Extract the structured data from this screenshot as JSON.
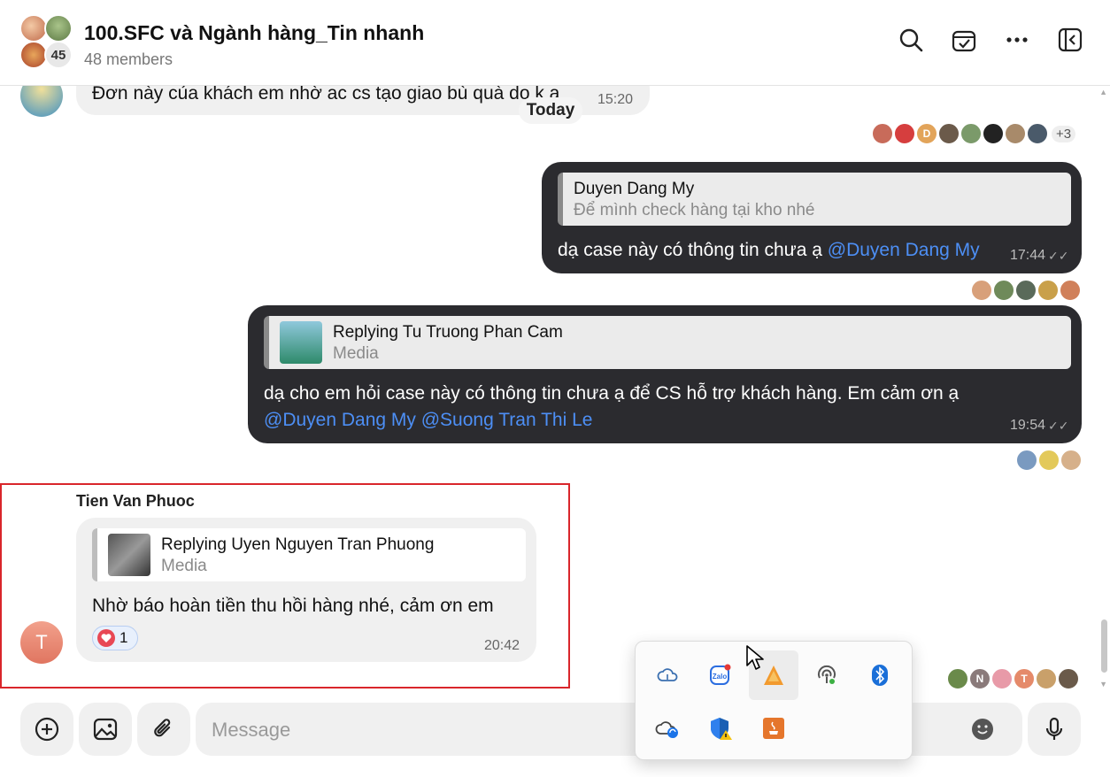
{
  "header": {
    "title": "100.SFC và Ngành hàng_Tin nhanh",
    "members": "48 members",
    "avatar_count": "45"
  },
  "date_divider": "Today",
  "messages": [
    {
      "text": "Đơn này của khách em nhờ ac cs tạo giao bù quà do k a",
      "time": "15:20",
      "seen_more": "+3"
    },
    {
      "quote_name": "Duyen Dang My",
      "quote_text": "Để mình check hàng tại kho nhé",
      "text": "dạ case này có thông tin chưa ạ ",
      "mention": "@Duyen Dang My",
      "time": "17:44"
    },
    {
      "quote_name": "Replying Tu Truong Phan Cam",
      "quote_text": "Media",
      "text": "dạ cho em hỏi case này có thông tin chưa ạ để CS hỗ trợ khách hàng. Em cảm ơn ạ",
      "mention1": "@Duyen Dang My",
      "mention2": "@Suong Tran Thi Le",
      "time": "19:54"
    },
    {
      "sender": "Tien Van Phuoc",
      "avatar_letter": "T",
      "quote_name": "Replying Uyen Nguyen Tran Phuong",
      "quote_text": "Media",
      "text": "Nhờ báo hoàn tiền thu hồi hàng nhé, cảm ơn em",
      "reaction_count": "1",
      "time": "20:42"
    }
  ],
  "seen_avatars_last": [
    "",
    "N",
    "",
    "T",
    "",
    ""
  ],
  "composer": {
    "placeholder": "Message"
  },
  "tray": {
    "icons": [
      "onedrive-icon",
      "zalo-icon",
      "app-orange-icon",
      "wifi-icon",
      "bluetooth-icon",
      "onedrive-sync-icon",
      "security-warning-icon",
      "java-icon"
    ]
  },
  "colors": {
    "bubble_out": "#2b2b2f",
    "bubble_in": "#f0f0f0",
    "mention": "#4d8ff5",
    "highlight": "#d9262b"
  }
}
